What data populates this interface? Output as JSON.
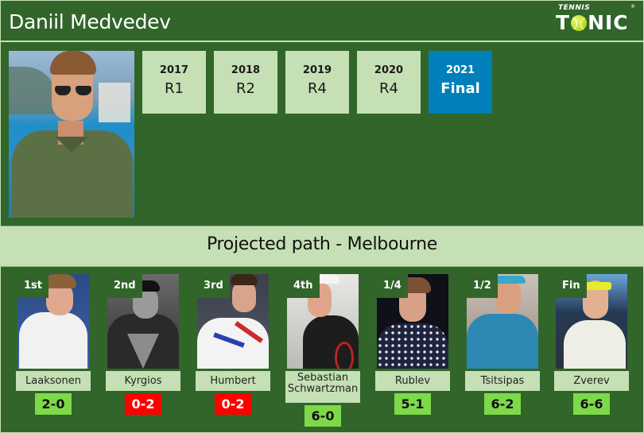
{
  "header": {
    "player_name": "Daniil Medvedev",
    "logo": {
      "top_text": "TENNIS",
      "main_text_left": "T",
      "main_text_right": "NIC",
      "ball_icon": "tennis-ball-icon",
      "registered": "®"
    }
  },
  "main_photo": {
    "subject": "Daniil Medvedev"
  },
  "history": [
    {
      "year": "2017",
      "result": "R1",
      "highlight": false
    },
    {
      "year": "2018",
      "result": "R2",
      "highlight": false
    },
    {
      "year": "2019",
      "result": "R4",
      "highlight": false
    },
    {
      "year": "2020",
      "result": "R4",
      "highlight": false
    },
    {
      "year": "2021",
      "result": "Final",
      "highlight": true
    }
  ],
  "section": {
    "title": "Projected path - Melbourne"
  },
  "path": [
    {
      "round": "1st",
      "name": "Laaksonen",
      "h2h": "2-0",
      "outcome": "win"
    },
    {
      "round": "2nd",
      "name": "Kyrgios",
      "h2h": "0-2",
      "outcome": "loss"
    },
    {
      "round": "3rd",
      "name": "Humbert",
      "h2h": "0-2",
      "outcome": "loss"
    },
    {
      "round": "4th",
      "name": "Sebastian Schwartzman",
      "h2h": "6-0",
      "outcome": "win"
    },
    {
      "round": "1/4",
      "name": "Rublev",
      "h2h": "5-1",
      "outcome": "win"
    },
    {
      "round": "1/2",
      "name": "Tsitsipas",
      "h2h": "6-2",
      "outcome": "win"
    },
    {
      "round": "Fin",
      "name": "Zverev",
      "h2h": "6-6",
      "outcome": "win"
    }
  ],
  "colors": {
    "background_green": "#31652a",
    "light_green": "#c5e0b4",
    "highlight_blue": "#0080bb",
    "win_green": "#7ed94a",
    "loss_red": "#ff0000"
  }
}
